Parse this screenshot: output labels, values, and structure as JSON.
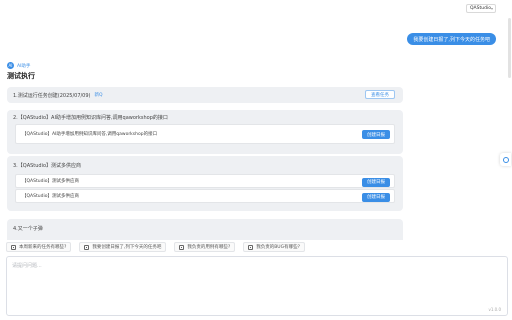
{
  "header": {
    "app_select_value": "QAStudio"
  },
  "chat": {
    "user_message": "我要创建日报了,列下今天的任务吧",
    "assistant_name": "AI助手",
    "assistant_avatar": "AI",
    "message_title": "测试执行",
    "cards": [
      {
        "title": "1.测试运行任务创建(2025/07/09)",
        "tag": "新Q",
        "action": "查看任务",
        "items": []
      },
      {
        "title": "2.【QAStudio】AI助手增加用例知识库问答,调用qaworkshop的接口",
        "items": [
          {
            "text": "【QAStudio】AI助手增加用例知识库问答,调用qaworkshop的接口",
            "action": "创建日报"
          }
        ]
      },
      {
        "title": "3.【QAStudio】测试多供应商",
        "items": [
          {
            "text": "【QAStudio】测试多供应商",
            "action": "创建日报"
          },
          {
            "text": "【QAStudio】测试多供应商",
            "action": "创建日报"
          }
        ]
      },
      {
        "title": "4.又一个子弹",
        "items": []
      }
    ]
  },
  "suggestions": [
    "本周新来的任务有哪些?",
    "我要创建日报了,列下今天的任务吧",
    "我负责的用例有哪些?",
    "我负责的BUG有哪些?"
  ],
  "input": {
    "placeholder": "请提问问题..."
  },
  "footer": {
    "version": "v1.0.0"
  },
  "colors": {
    "accent": "#3a8ee6",
    "card_bg": "#eef0f3"
  }
}
